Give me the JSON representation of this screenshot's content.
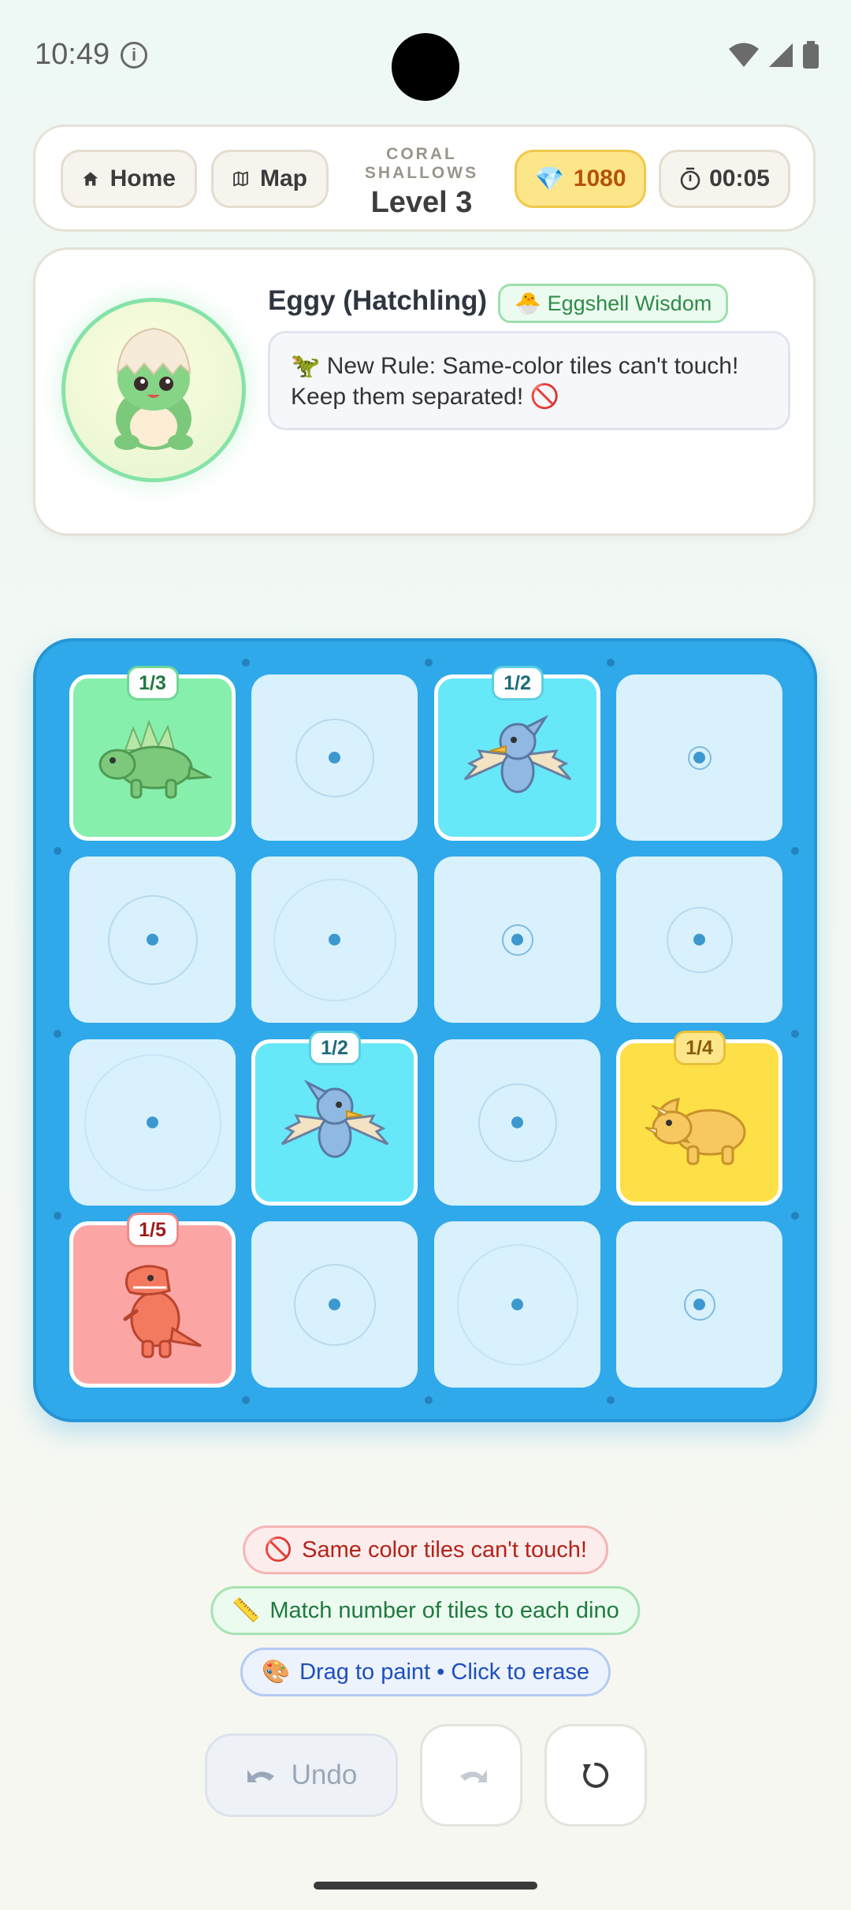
{
  "status_bar": {
    "time": "10:49"
  },
  "header": {
    "home_label": "Home",
    "map_label": "Map",
    "region": "CORAL SHALLOWS",
    "level": "Level 3",
    "gems": "1080",
    "timer": "00:05"
  },
  "mentor": {
    "name": "Eggy (Hatchling)",
    "badge": "Eggshell Wisdom",
    "message": "🦖 New Rule: Same-color tiles can't touch! Keep them separated! 🚫"
  },
  "board": {
    "clues": {
      "stego": "1/3",
      "ptero_top": "1/2",
      "ptero_mid": "1/2",
      "trike": "1/4",
      "rex": "1/5"
    },
    "colors": {
      "green": "#86efac",
      "cyan": "#67e8f9",
      "yellow": "#fde047",
      "red": "#fca5a5"
    }
  },
  "hints": [
    {
      "icon": "🚫",
      "text": "Same color tiles can't touch!"
    },
    {
      "icon": "📏",
      "text": "Match number of tiles to each dino"
    },
    {
      "icon": "🎨",
      "text": "Drag to paint • Click to erase"
    }
  ],
  "controls": {
    "undo_label": "Undo"
  }
}
